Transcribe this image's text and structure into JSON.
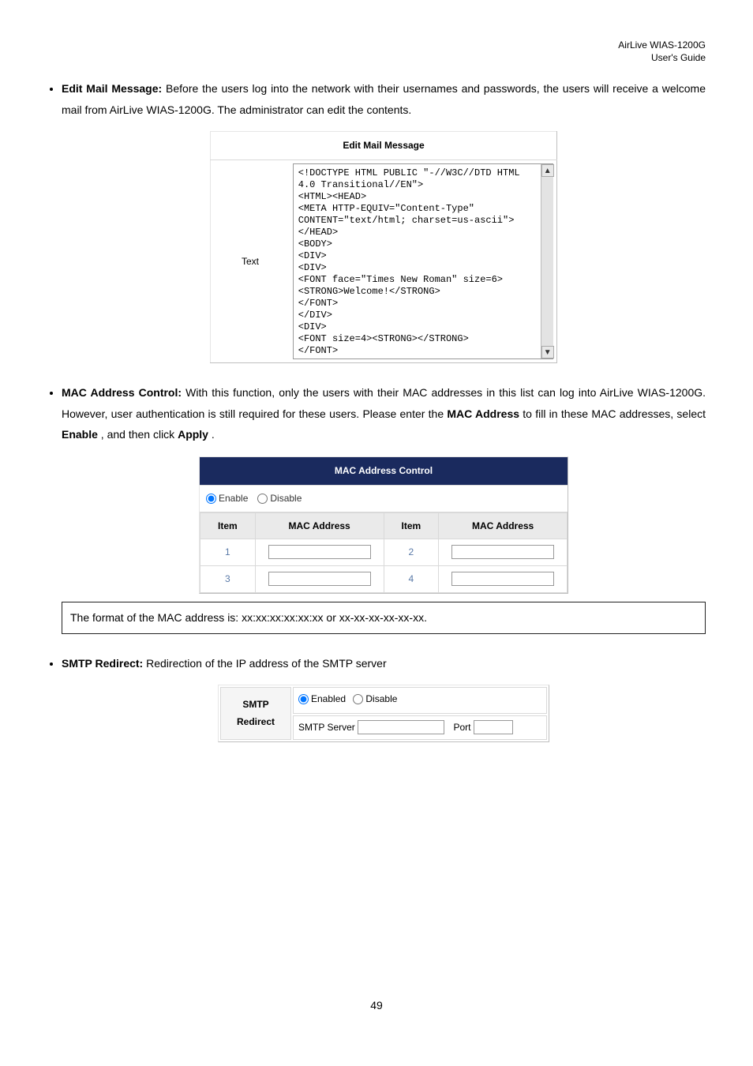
{
  "header": {
    "line1": "AirLive WIAS-1200G",
    "line2": "User's Guide"
  },
  "section1": {
    "label": "Edit Mail Message:",
    "intro": "Before the users log into the network with their usernames and passwords, the users will receive a welcome mail from AirLive WIAS-1200G. The administrator can edit the contents.",
    "panelTitle": "Edit Mail Message",
    "fieldLabel": "Text",
    "textarea": "<!DOCTYPE HTML PUBLIC \"-//W3C//DTD HTML\n4.0 Transitional//EN\">\n<HTML><HEAD>\n<META HTTP-EQUIV=\"Content-Type\"\nCONTENT=\"text/html; charset=us-ascii\">\n</HEAD>\n<BODY>\n<DIV>\n<DIV>\n<FONT face=\"Times New Roman\" size=6>\n<STRONG>Welcome!</STRONG>\n</FONT>\n</DIV>\n<DIV>\n<FONT size=4><STRONG></STRONG>\n</FONT>"
  },
  "section2": {
    "label": "MAC Address Control:",
    "intro_a": "With this function, only the users with their MAC addresses in this list can log into AirLive WIAS-1200G. However, user authentication is still required for these users. Please enter the ",
    "macaddr_label": "MAC Address",
    "intro_b": " to fill in these MAC addresses, select ",
    "enable_label": "Enable",
    "intro_c": ", and then click ",
    "apply_label": "Apply",
    "intro_d": ".",
    "panelTitle": "MAC Address Control",
    "radioEnable": "Enable",
    "radioDisable": "Disable",
    "th_item": "Item",
    "th_mac": "MAC Address",
    "rows": [
      [
        "1",
        "2"
      ],
      [
        "3",
        "4"
      ]
    ],
    "note": "The format of the MAC address is: xx:xx:xx:xx:xx:xx or xx-xx-xx-xx-xx-xx."
  },
  "section3": {
    "label": "SMTP Redirect:",
    "intro": "Redirection of the IP address of the SMTP server",
    "rowLabel": "SMTP Redirect",
    "radioEnabled": "Enabled",
    "radioDisable": "Disable",
    "smtpServerLbl": "SMTP Server",
    "portLbl": "Port"
  },
  "footer": {
    "page": "49"
  }
}
